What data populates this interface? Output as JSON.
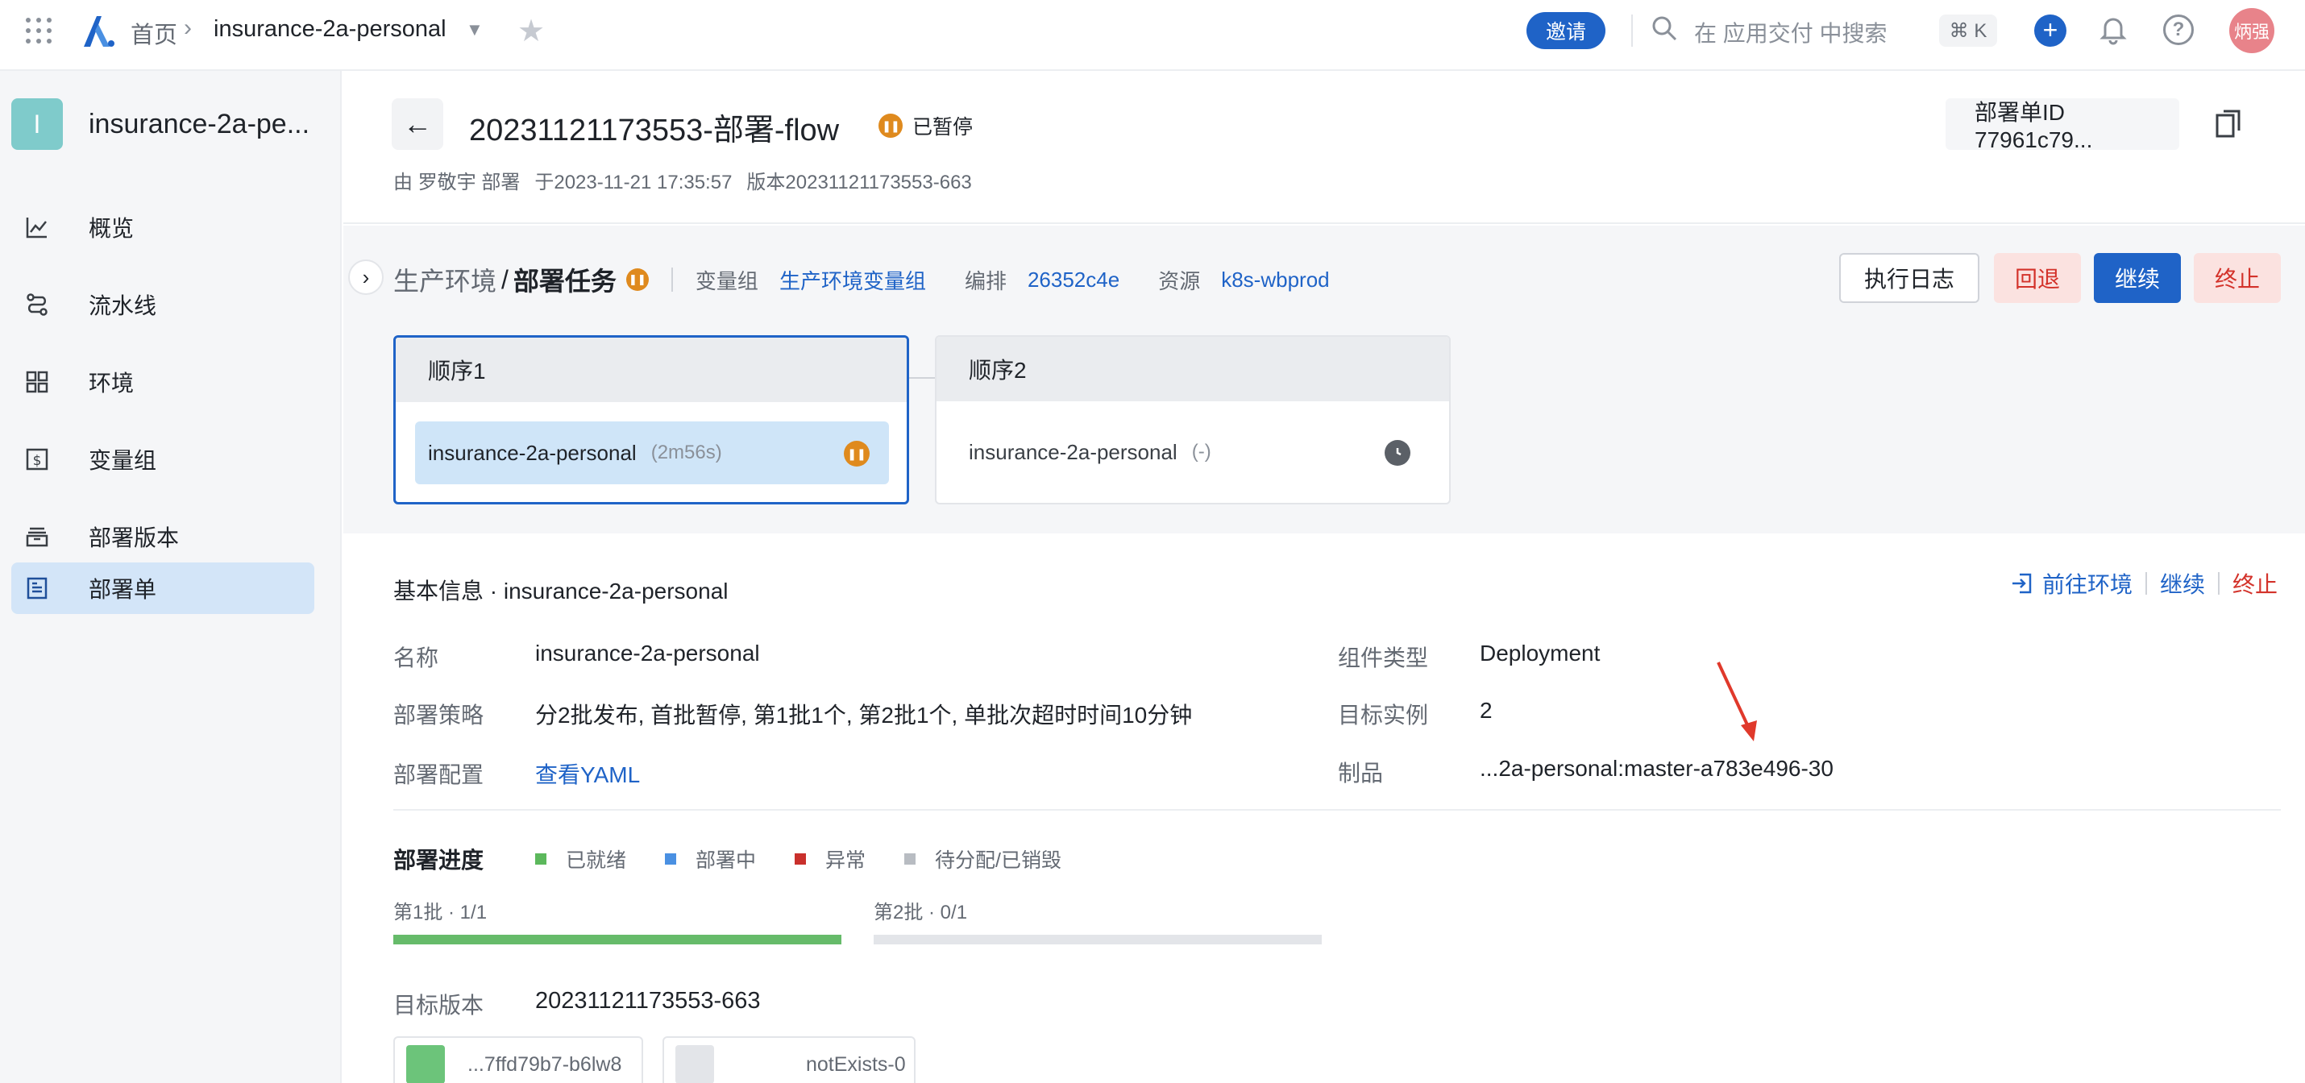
{
  "topbar": {
    "home": "首页",
    "project": "insurance-2a-personal",
    "invite": "邀请",
    "search_placeholder": "在 应用交付 中搜索",
    "shortcut": "⌘ K",
    "avatar_text": "炳强"
  },
  "sidebar": {
    "project_initial": "I",
    "project_name": "insurance-2a-pe...",
    "items": [
      {
        "label": "概览",
        "icon": "chart-line-icon"
      },
      {
        "label": "流水线",
        "icon": "pipeline-icon"
      },
      {
        "label": "环境",
        "icon": "grid-icon"
      },
      {
        "label": "变量组",
        "icon": "dollar-box-icon"
      },
      {
        "label": "部署版本",
        "icon": "archive-icon"
      },
      {
        "label": "部署单",
        "icon": "document-icon",
        "active": true
      }
    ]
  },
  "header": {
    "title": "20231121173553-部署-flow",
    "status": "已暂停",
    "meta": [
      "由 罗敬宇 部署",
      "于2023-11-21 17:35:57",
      "版本20231121173553-663"
    ],
    "id_label": "部署单ID 77961c79..."
  },
  "env": {
    "name": "生产环境",
    "slash": "/",
    "task": "部署任务",
    "vargroup_key": "变量组",
    "vargroup_val": "生产环境变量组",
    "orch_key": "编排",
    "orch_val": "26352c4e",
    "res_key": "资源",
    "res_val": "k8s-wbprod",
    "btn_log": "执行日志",
    "btn_rollback": "回退",
    "btn_continue": "继续",
    "btn_stop": "终止"
  },
  "stages": [
    {
      "title": "顺序1",
      "job": "insurance-2a-personal",
      "duration": "(2m56s)",
      "status": "paused"
    },
    {
      "title": "顺序2",
      "job": "insurance-2a-personal",
      "duration": "(-)",
      "status": "waiting"
    }
  ],
  "detail": {
    "title": "基本信息 · insurance-2a-personal",
    "goto_env": "前往环境",
    "continue": "继续",
    "stop": "终止",
    "name_label": "名称",
    "name_value": "insurance-2a-personal",
    "strategy_label": "部署策略",
    "strategy_value": "分2批发布, 首批暂停, 第1批1个, 第2批1个, 单批次超时时间10分钟",
    "config_label": "部署配置",
    "config_value": "查看YAML",
    "kind_label": "组件类型",
    "kind_value": "Deployment",
    "replicas_label": "目标实例",
    "replicas_value": "2",
    "artifact_label": "制品",
    "artifact_value": "...2a-personal:master-a783e496-30"
  },
  "progress": {
    "title": "部署进度",
    "legend": [
      {
        "label": "已就绪",
        "color": "#5cb85c"
      },
      {
        "label": "部署中",
        "color": "#4a90e2"
      },
      {
        "label": "异常",
        "color": "#c9302c"
      },
      {
        "label": "待分配/已销毁",
        "color": "#b8bcc2"
      }
    ],
    "batches": [
      {
        "label": "第1批 · 1/1",
        "fraction": 1.0
      },
      {
        "label": "第2批 · 0/1",
        "fraction": 0.0
      }
    ],
    "target_label": "目标版本",
    "target_value": "20231121173553-663",
    "pods": [
      {
        "name": "...7ffd79b7-b6lw8",
        "color": "#6cc47a"
      },
      {
        "name": "notExists-0",
        "color": "#e3e5e9"
      }
    ]
  },
  "colors": {
    "accent": "#1f63c7",
    "danger": "#d3322a",
    "paused": "#df8a1e"
  }
}
